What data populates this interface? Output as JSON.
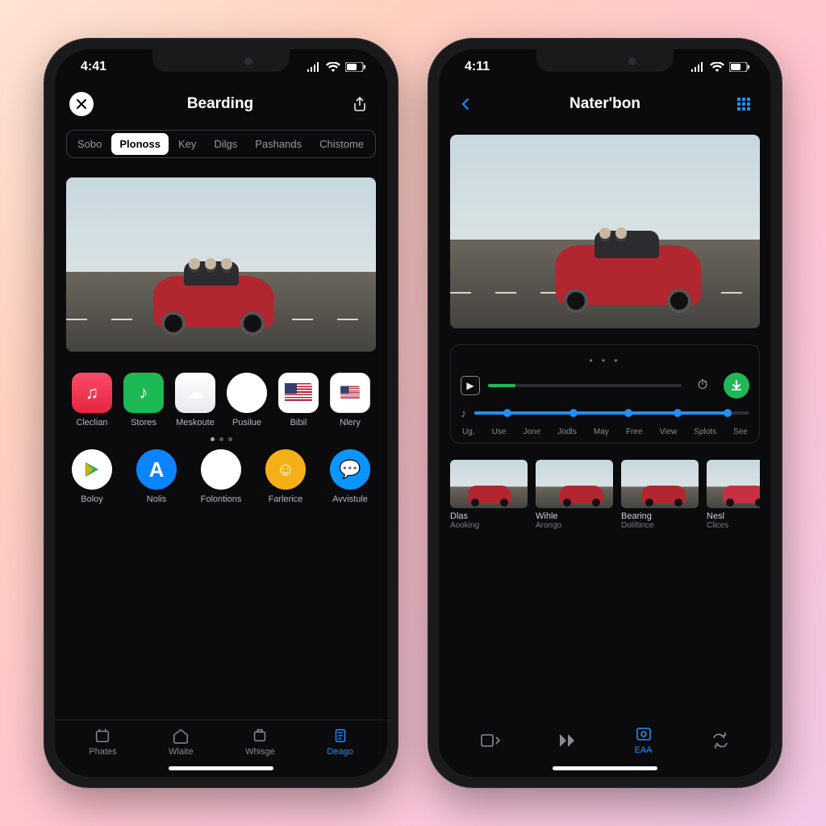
{
  "colors": {
    "accent": "#1e90ff",
    "green": "#1fb758"
  },
  "left": {
    "status": {
      "time": "4:41"
    },
    "nav": {
      "title": "Bearding"
    },
    "segments": [
      "Sobo",
      "Plonoss",
      "Key",
      "Dilgs",
      "Pashands",
      "Chistome"
    ],
    "segments_active_index": 1,
    "app_row1": [
      {
        "label": "Cleclian",
        "name": "music"
      },
      {
        "label": "Stores",
        "name": "spotify"
      },
      {
        "label": "Meskoute",
        "name": "cloud"
      },
      {
        "label": "Pusilue",
        "name": "google"
      },
      {
        "label": "Bibil",
        "name": "flag"
      },
      {
        "label": "Nlery",
        "name": "news"
      }
    ],
    "app_row2": [
      {
        "label": "Boloy",
        "name": "play"
      },
      {
        "label": "Nolis",
        "name": "appstore"
      },
      {
        "label": "Folontions",
        "name": "pinterest"
      },
      {
        "label": "Farlerice",
        "name": "ambient"
      },
      {
        "label": "Avvistule",
        "name": "chat"
      }
    ],
    "tabs": [
      "Phates",
      "Wlaite",
      "Whisge",
      "Deago"
    ],
    "tabs_active_index": 3
  },
  "right": {
    "status": {
      "time": "4:11"
    },
    "nav": {
      "title": "Nater'bon"
    },
    "ticks": [
      "Ug,",
      "Use",
      "Jone",
      "Jodls",
      "May",
      "Free",
      "View",
      "Splots",
      "See"
    ],
    "progress1_pct": 14,
    "slider_dots_pct": [
      12,
      36,
      56,
      74,
      92
    ],
    "thumbs": [
      {
        "t1": "Dlas",
        "t2": "Aooking"
      },
      {
        "t1": "Wihle",
        "t2": "Arongo"
      },
      {
        "t1": "Bearing",
        "t2": "Doliltince"
      },
      {
        "t1": "Nesl",
        "t2": "Clices"
      }
    ],
    "tabs": [
      "",
      "",
      "EAA",
      ""
    ],
    "tabs_active_index": 2
  }
}
